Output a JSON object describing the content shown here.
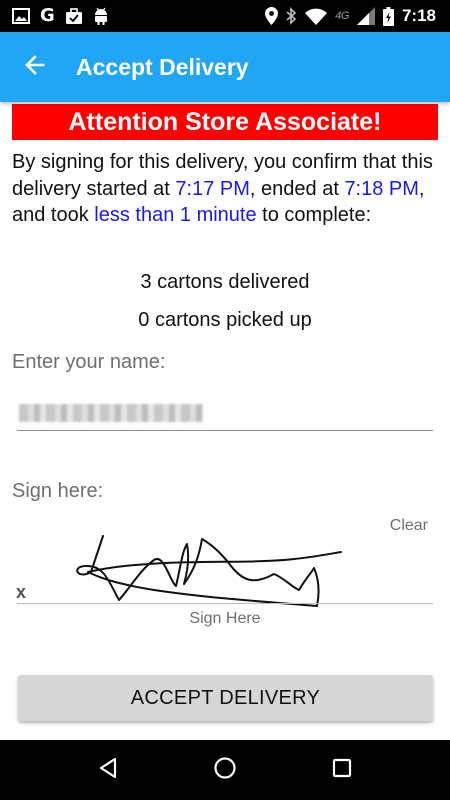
{
  "status_bar": {
    "time": "7:18",
    "network_label": "4G",
    "left_icons": [
      "image-icon",
      "google-icon",
      "briefcase-icon",
      "android-icon"
    ],
    "right_icons": [
      "location-icon",
      "bluetooth-icon",
      "wifi-icon",
      "signal-icon",
      "battery-icon"
    ],
    "g_letter": "G"
  },
  "app_bar": {
    "title": "Accept Delivery",
    "color": "#21a5f5"
  },
  "banner": {
    "text": "Attention Store Associate!",
    "color": "#ff0000"
  },
  "confirmation": {
    "part1": "By signing for this delivery, you confirm that this delivery started at ",
    "start_time": "7:17 PM",
    "part2": ", ended at ",
    "end_time": "7:18 PM",
    "part3": ", and took ",
    "duration": "less than 1 minute",
    "part4": " to complete:",
    "highlight_color": "#1a1ae6"
  },
  "counts": {
    "delivered": "3 cartons delivered",
    "picked_up": "0 cartons picked up"
  },
  "name_field": {
    "label": "Enter your name:",
    "value": ""
  },
  "signature": {
    "label": "Sign here:",
    "clear": "Clear",
    "x_mark": "x",
    "caption": "Sign Here"
  },
  "accept_button": {
    "label": "ACCEPT DELIVERY"
  },
  "nav_bar": {
    "icons": [
      "back-triangle-icon",
      "home-circle-icon",
      "recents-square-icon"
    ]
  }
}
